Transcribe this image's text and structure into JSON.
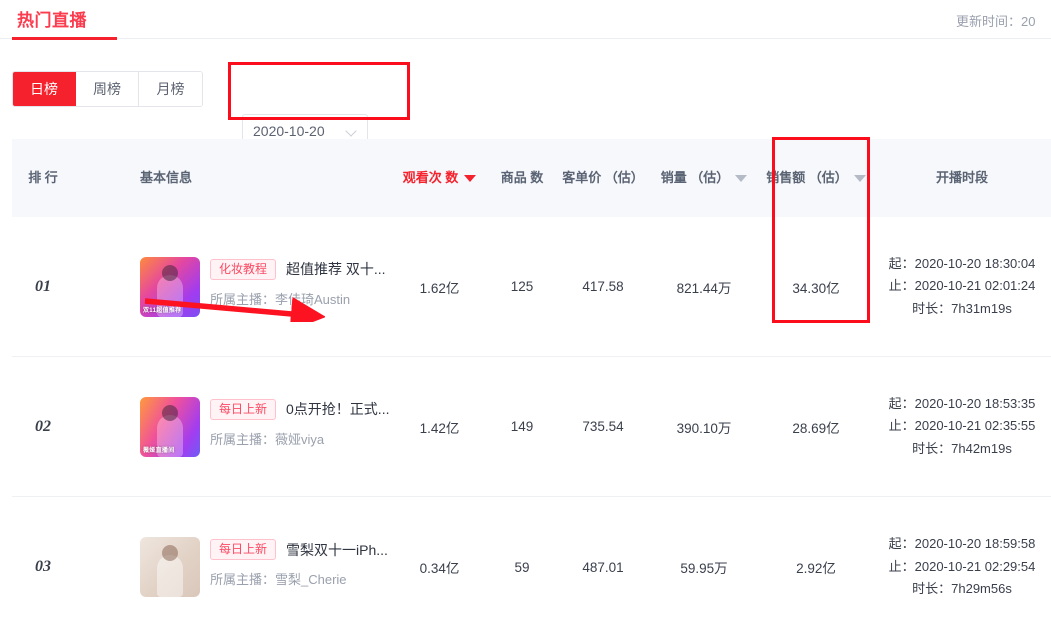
{
  "header": {
    "title": "热门直播",
    "update_time": "更新时间：20"
  },
  "filters": {
    "tabs": [
      {
        "label": "日榜",
        "active": true
      },
      {
        "label": "周榜",
        "active": false
      },
      {
        "label": "月榜",
        "active": false
      }
    ],
    "date_picker": {
      "value": "2020-10-20",
      "icon": "chevron-down-icon"
    }
  },
  "table": {
    "columns": [
      {
        "key": "rank",
        "label": "排\n行",
        "sorted": false,
        "caret": false
      },
      {
        "key": "info",
        "label": "基本信息",
        "sorted": false,
        "caret": false
      },
      {
        "key": "views",
        "label": "观看次\n数",
        "sorted": true,
        "caret": true
      },
      {
        "key": "goods",
        "label": "商品\n数",
        "sorted": false,
        "caret": false
      },
      {
        "key": "price",
        "label": "客单价\n（估）",
        "sorted": false,
        "caret": false
      },
      {
        "key": "sales",
        "label": "销量\n（估）",
        "sorted": false,
        "caret": true
      },
      {
        "key": "amount",
        "label": "销售额\n（估）",
        "sorted": false,
        "caret": true
      },
      {
        "key": "time",
        "label": "开播时段",
        "sorted": false,
        "caret": false
      }
    ],
    "rows": [
      {
        "rank": "01",
        "tag": "化妆教程",
        "title": "超值推荐 双十...",
        "host": "所属主播：李佳琦Austin",
        "thumb_caption": "双11超值推荐",
        "views": "1.62亿",
        "goods": "125",
        "price": "417.58",
        "sales": "821.44万",
        "amount": "34.30亿",
        "start": "起：2020-10-20 18:30:04",
        "end": "止：2020-10-21 02:01:24",
        "duration": "时长：7h31m19s"
      },
      {
        "rank": "02",
        "tag": "每日上新",
        "title": "0点开抢！正式...",
        "host": "所属主播：薇娅viya",
        "thumb_caption": "薇娅直播间",
        "views": "1.42亿",
        "goods": "149",
        "price": "735.54",
        "sales": "390.10万",
        "amount": "28.69亿",
        "start": "起：2020-10-20 18:53:35",
        "end": "止：2020-10-21 02:35:55",
        "duration": "时长：7h42m19s"
      },
      {
        "rank": "03",
        "tag": "每日上新",
        "title": "雪梨双十一iPh...",
        "host": "所属主播：雪梨_Cherie",
        "thumb_caption": "",
        "views": "0.34亿",
        "goods": "59",
        "price": "487.01",
        "sales": "59.95万",
        "amount": "2.92亿",
        "start": "起：2020-10-20 18:59:58",
        "end": "止：2020-10-21 02:29:54",
        "duration": "时长：7h29m56s"
      }
    ]
  },
  "annotations": {
    "color": "#fc0d1b",
    "boxes": [
      "date-picker-highlight",
      "sales-amount-column-highlight"
    ],
    "arrow": "host-row-arrow"
  }
}
